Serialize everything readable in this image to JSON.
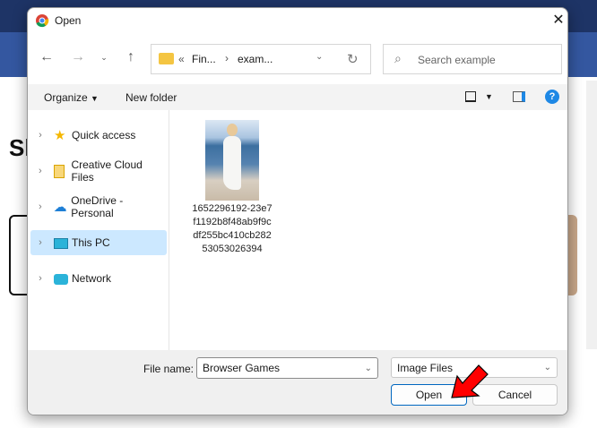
{
  "background": {
    "heading_fragment": "Sh"
  },
  "dialog": {
    "title": "Open",
    "address": {
      "prefix": "«",
      "crumbs": [
        "Fin...",
        "exam..."
      ]
    },
    "search_placeholder": "Search example",
    "toolbar": {
      "organize": "Organize",
      "new_folder": "New folder"
    },
    "nav_items": [
      {
        "label": "Quick access",
        "icon": "star-icon"
      },
      {
        "label": "Creative Cloud Files",
        "icon": "creative-cloud-folder-icon"
      },
      {
        "label": "OneDrive - Personal",
        "icon": "cloud-icon"
      },
      {
        "label": "This PC",
        "icon": "monitor-icon",
        "selected": true
      },
      {
        "label": "Network",
        "icon": "network-icon"
      }
    ],
    "file": {
      "name_lines": [
        "1652296192-23e7",
        "f1192b8f48ab9f9c",
        "df255bc410cb282",
        "53053026394"
      ]
    },
    "file_name_label": "File name:",
    "file_name_value": "Browser Games",
    "file_type": "Image Files",
    "open_label": "Open",
    "cancel_label": "Cancel"
  },
  "colors": {
    "accent": "#0067c0",
    "selected": "#cce8ff",
    "arrow": "#ff0000"
  }
}
